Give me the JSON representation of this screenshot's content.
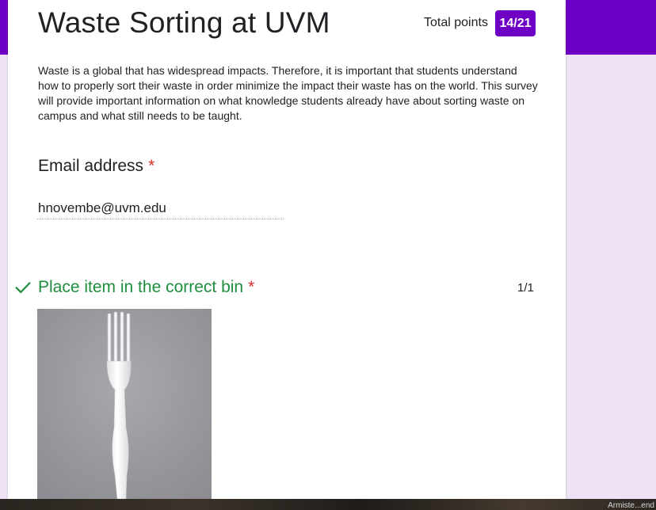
{
  "form": {
    "title": "Waste Sorting at UVM",
    "total_points_label": "Total points",
    "total_points_value": "14/21",
    "description": "Waste is a global that has widespread impacts. Therefore, it is important that students understand how to properly sort their waste in order minimize the impact their waste has on the world. This survey will provide important information on what knowledge students already have about sorting waste on campus and what still needs to be taught."
  },
  "email_question": {
    "label": "Email address",
    "required_mark": "*",
    "value": "hnovembe@uvm.edu"
  },
  "question_1": {
    "title": "Place item in the correct bin",
    "required_mark": "*",
    "score": "1/1",
    "status_icon": "check-icon",
    "image_subject": "plastic-fork"
  },
  "taskbar": {
    "label": "Armiste...end"
  },
  "colors": {
    "accent": "#6d00c4",
    "background": "#ede3f5",
    "correct": "#1e8e3e",
    "required": "#d93025"
  }
}
